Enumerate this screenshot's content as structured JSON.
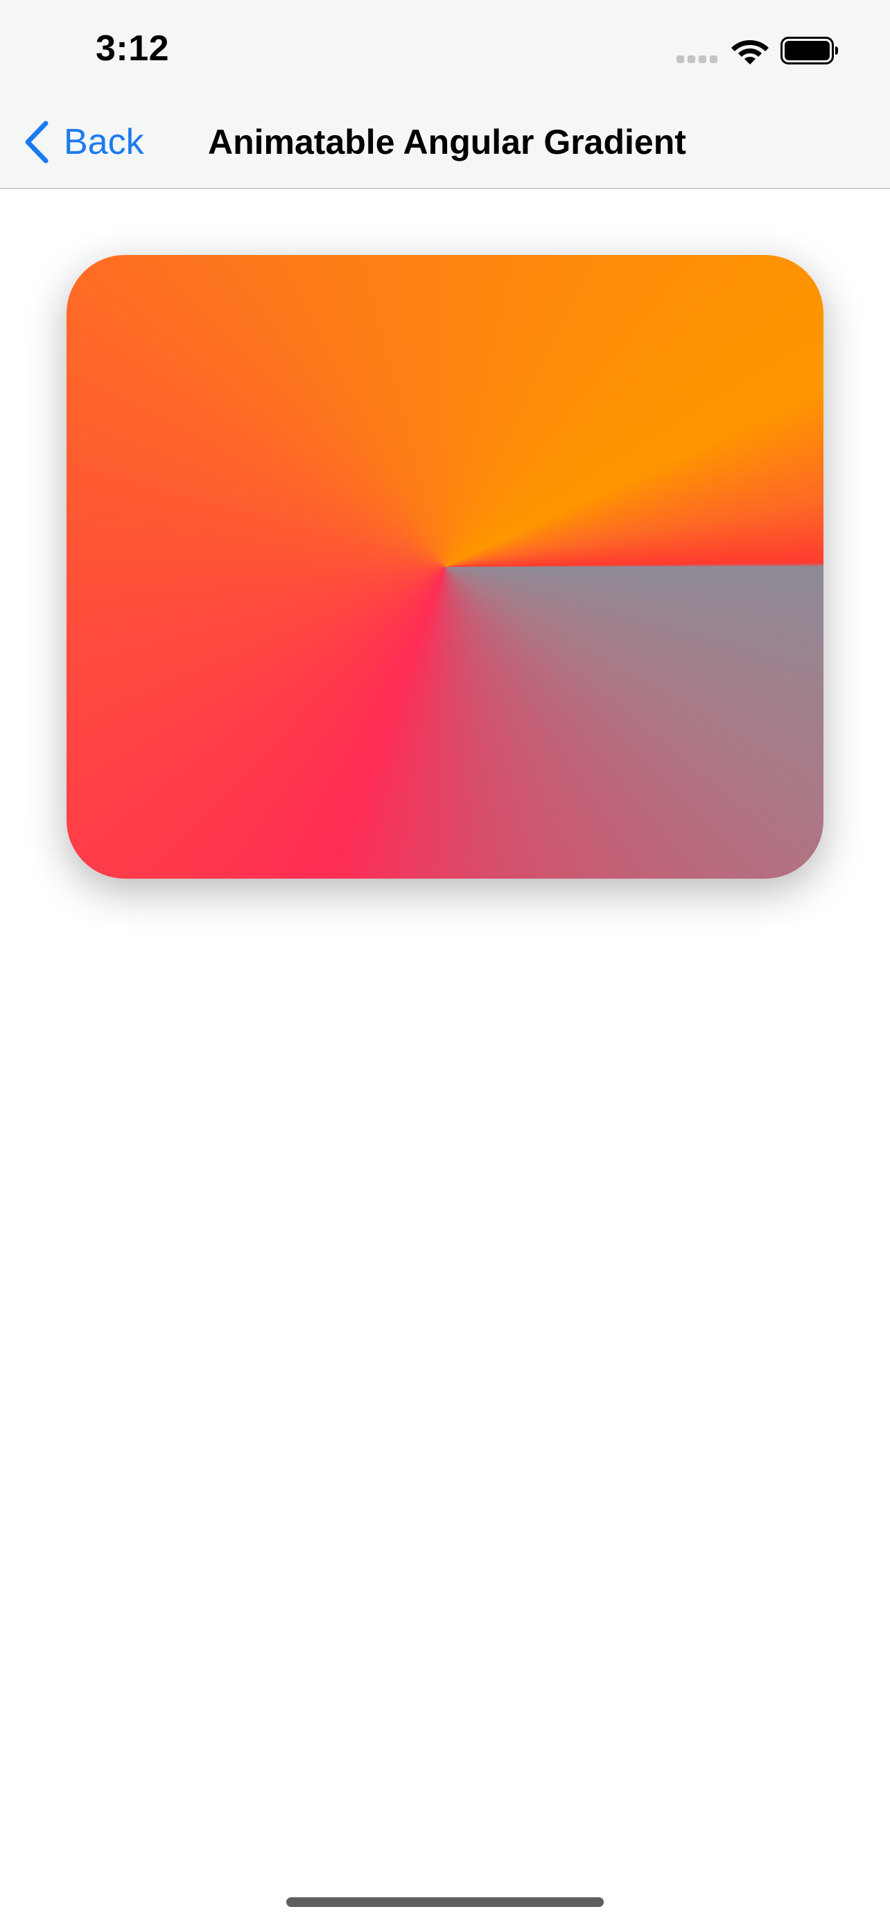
{
  "status_bar": {
    "time": "3:12",
    "signal_icon": "cellular-signal-icon",
    "wifi_icon": "wifi-icon",
    "battery_icon": "battery-icon"
  },
  "nav": {
    "back_label": "Back",
    "back_icon": "chevron-left-icon",
    "title": "Animatable Angular Gradient"
  },
  "content": {
    "gradient_colors": [
      "#ff9500",
      "#ff3b30",
      "#8e8b97",
      "#ff2d55"
    ]
  },
  "colors": {
    "accent": "#1a7bf0",
    "bar_background": "#f5f6f6"
  }
}
